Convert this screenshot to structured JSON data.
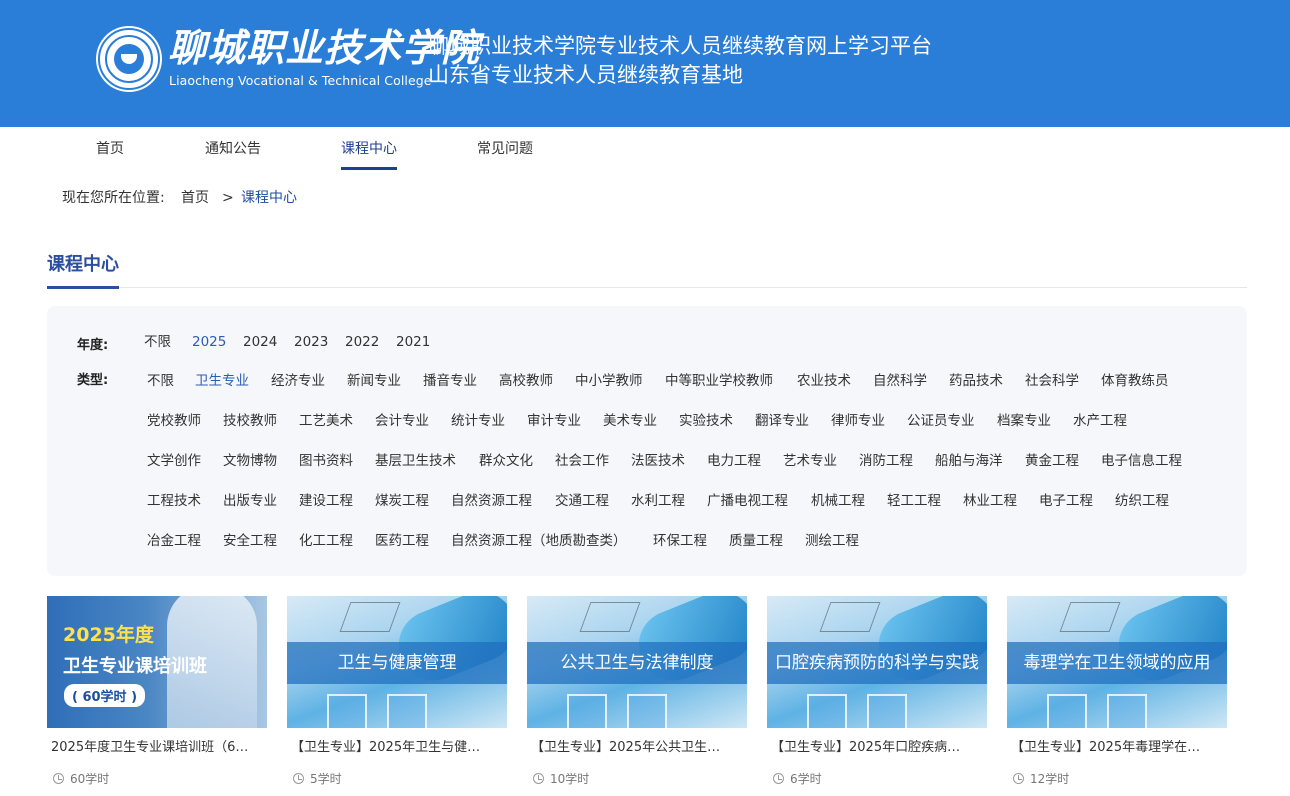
{
  "header": {
    "logo_cn": "聊城职业技术学院",
    "logo_en": "Liaocheng Vocational & Technical College",
    "title_line1": "聊城职业技术学院专业技术人员继续教育网上学习平台",
    "title_line2": "山东省专业技术人员继续教育基地"
  },
  "nav": {
    "items": [
      {
        "label": "首页"
      },
      {
        "label": "通知公告"
      },
      {
        "label": "课程中心"
      },
      {
        "label": "常见问题"
      }
    ],
    "active": "课程中心"
  },
  "breadcrumb": {
    "prefix": "现在您所在位置:",
    "home": "首页",
    "sep": ">",
    "current": "课程中心"
  },
  "section": {
    "title": "课程中心"
  },
  "filters": {
    "year_label": "年度:",
    "years": [
      "不限",
      "2025",
      "2024",
      "2023",
      "2022",
      "2021"
    ],
    "year_selected": "2025",
    "type_label": "类型:",
    "type_rows": [
      [
        "不限",
        "卫生专业",
        "经济专业",
        "新闻专业",
        "播音专业",
        "高校教师",
        "中小学教师",
        "中等职业学校教师",
        "农业技术",
        "自然科学",
        "药品技术",
        "社会科学",
        "体育教练员"
      ],
      [
        "党校教师",
        "技校教师",
        "工艺美术",
        "会计专业",
        "统计专业",
        "审计专业",
        "美术专业",
        "实验技术",
        "翻译专业",
        "律师专业",
        "公证员专业",
        "档案专业",
        "水产工程"
      ],
      [
        "文学创作",
        "文物博物",
        "图书资料",
        "基层卫生技术",
        "群众文化",
        "社会工作",
        "法医技术",
        "电力工程",
        "艺术专业",
        "消防工程",
        "船舶与海洋",
        "黄金工程",
        "电子信息工程"
      ],
      [
        "工程技术",
        "出版专业",
        "建设工程",
        "煤炭工程",
        "自然资源工程",
        "交通工程",
        "水利工程",
        "广播电视工程",
        "机械工程",
        "轻工工程",
        "林业工程",
        "电子工程",
        "纺织工程"
      ],
      [
        "冶金工程",
        "安全工程",
        "化工工程",
        "医药工程",
        "自然资源工程（地质勘查类）",
        "环保工程",
        "质量工程",
        "测绘工程"
      ]
    ],
    "type_selected": "卫生专业"
  },
  "courses": [
    {
      "thumb_kind": "promo",
      "promo_year": "2025年度",
      "promo_title": "卫生专业课培训班",
      "promo_hours": "( 60学时 )",
      "title": "2025年度卫生专业课培训班（6…",
      "hours": "60学时"
    },
    {
      "thumb_kind": "lab",
      "banner": "卫生与健康管理",
      "title": "【卫生专业】2025年卫生与健…",
      "hours": "5学时"
    },
    {
      "thumb_kind": "lab",
      "banner": "公共卫生与法律制度",
      "title": "【卫生专业】2025年公共卫生…",
      "hours": "10学时"
    },
    {
      "thumb_kind": "lab",
      "banner": "口腔疾病预防的科学与实践",
      "title": "【卫生专业】2025年口腔疾病…",
      "hours": "6学时"
    },
    {
      "thumb_kind": "lab",
      "banner": "毒理学在卫生领域的应用",
      "title": "【卫生专业】2025年毒理学在…",
      "hours": "12学时"
    }
  ]
}
